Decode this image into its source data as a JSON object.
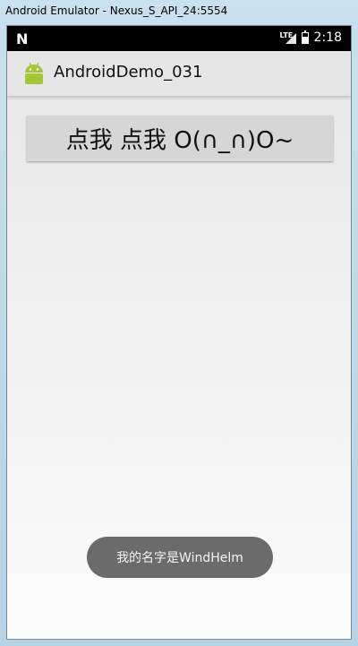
{
  "window": {
    "title": "Android Emulator - Nexus_S_API_24:5554"
  },
  "statusbar": {
    "logo": "N",
    "network": "LTE",
    "time": "2:18"
  },
  "appbar": {
    "title": "AndroidDemo_031",
    "logo_icon": "android-icon"
  },
  "main": {
    "button_label": "点我 点我  O(∩_∩)O~"
  },
  "toast": {
    "message": "我的名字是WindHelm"
  },
  "colors": {
    "appbar_bg": "#e6e6e6",
    "button_bg": "#d6d6d6",
    "toast_bg": "#6b6b6b",
    "android_green": "#a4c639"
  }
}
